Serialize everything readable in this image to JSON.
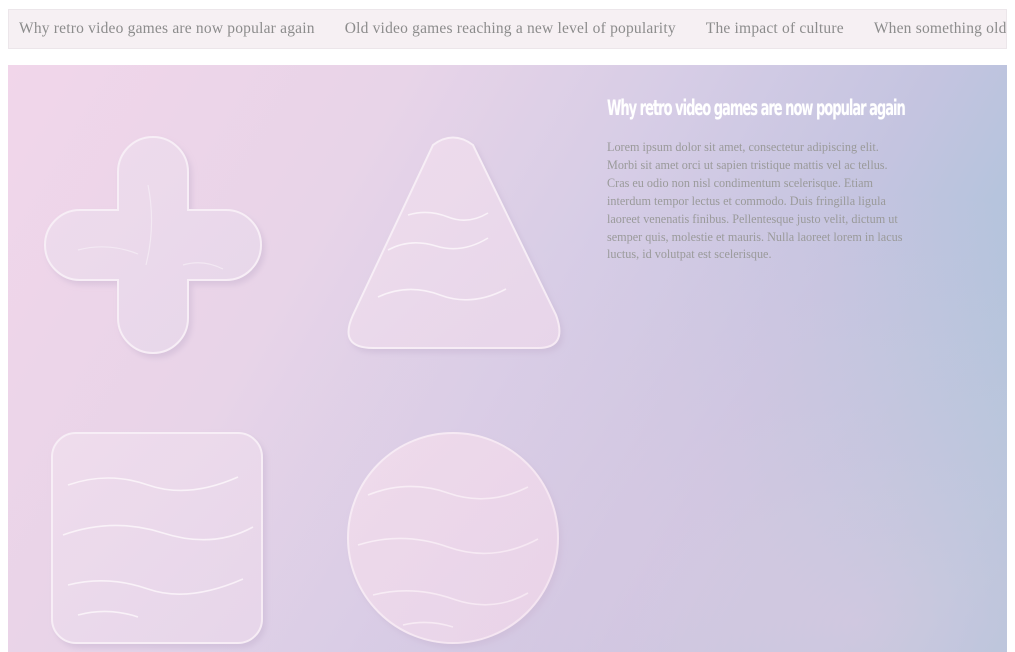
{
  "nav": {
    "items": [
      {
        "label": "Why retro video games are now popular again"
      },
      {
        "label": "Old video games reaching a new level of popularity"
      },
      {
        "label": "The impact of culture"
      },
      {
        "label": "When something old is new again"
      }
    ]
  },
  "hero": {
    "icons": [
      "plus-icon",
      "triangle-icon",
      "square-icon",
      "circle-icon"
    ],
    "colors": {
      "gradient_start": "#f1d6ea",
      "gradient_end": "#99c0d6",
      "nav_background": "#f6f0f3",
      "title": "#ffffff",
      "body_text": "#9a9a9a"
    }
  },
  "article": {
    "title": "Why retro video games are now popular again",
    "body": "Lorem ipsum dolor sit amet, consectetur adipiscing elit. Morbi sit amet orci ut sapien tristique mattis vel ac tellus. Cras eu odio non nisl condimentum scelerisque. Etiam interdum tempor lectus et commodo. Duis fringilla ligula laoreet venenatis finibus. Pellentesque justo velit, dictum ut semper quis, molestie et mauris. Nulla laoreet lorem in lacus luctus, id volutpat est scelerisque."
  }
}
